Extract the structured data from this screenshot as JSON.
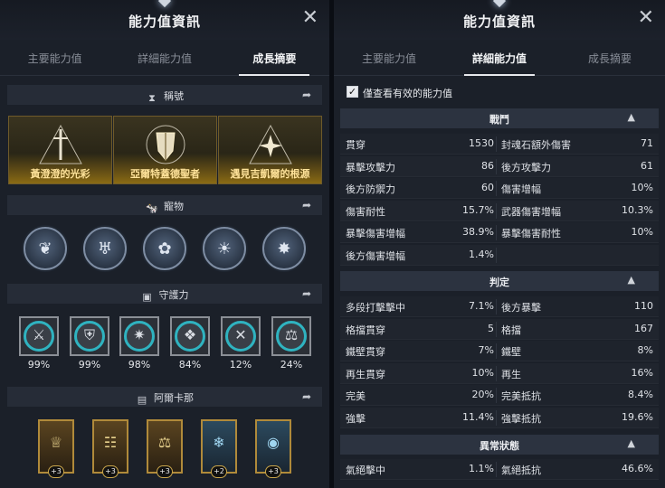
{
  "left": {
    "title": "能力值資訊",
    "close": "✕",
    "tabs": [
      "主要能力值",
      "詳細能力值",
      "成長摘要"
    ],
    "sections": {
      "titles": "稱號",
      "pets": "寵物",
      "guardians": "守護力",
      "arcana": "阿爾卡那"
    },
    "title_cards": [
      "黃澄澄的光彩",
      "亞爾特蓋德聖者",
      "遇見吉凱爾的根源"
    ],
    "pets_icons": [
      "wing-icon",
      "demon-icon",
      "lotus-icon",
      "sun-icon",
      "star-icon"
    ],
    "guardians": [
      {
        "icon": "sword-icon",
        "pct": "99%"
      },
      {
        "icon": "armor-icon",
        "pct": "99%"
      },
      {
        "icon": "beast-icon",
        "pct": "98%"
      },
      {
        "icon": "moth-icon",
        "pct": "84%"
      },
      {
        "icon": "cross-icon",
        "pct": "12%"
      },
      {
        "icon": "scale-icon",
        "pct": "24%"
      }
    ],
    "arcana": [
      {
        "icon": "chalice-icon",
        "count": "+3"
      },
      {
        "icon": "scroll-icon",
        "count": "+3"
      },
      {
        "icon": "balance-icon",
        "count": "+3"
      },
      {
        "icon": "crystal-icon",
        "count": "+2"
      },
      {
        "icon": "orb-icon",
        "count": "+3"
      }
    ],
    "colors": {
      "accent_gold": "#ffe39a",
      "guardian_ring": "#2fb3c0"
    }
  },
  "right": {
    "title": "能力值資訊",
    "close": "✕",
    "tabs": [
      "主要能力值",
      "詳細能力值",
      "成長摘要"
    ],
    "checkbox": {
      "label": "僅查看有效的能力值",
      "checked": "✓"
    },
    "groups": [
      {
        "name": "戰鬥",
        "rows": [
          [
            "貫穿",
            "1530",
            "封魂石額外傷害",
            "71"
          ],
          [
            "暴擊攻擊力",
            "86",
            "後方攻擊力",
            "61"
          ],
          [
            "後方防禦力",
            "60",
            "傷害增幅",
            "10%"
          ],
          [
            "傷害耐性",
            "15.7%",
            "武器傷害增幅",
            "10.3%"
          ],
          [
            "暴擊傷害增幅",
            "38.9%",
            "暴擊傷害耐性",
            "10%"
          ],
          [
            "後方傷害增幅",
            "1.4%",
            "",
            ""
          ]
        ]
      },
      {
        "name": "判定",
        "rows": [
          [
            "多段打擊擊中",
            "7.1%",
            "後方暴擊",
            "110"
          ],
          [
            "格擋貫穿",
            "5",
            "格擋",
            "167"
          ],
          [
            "鐵壁貫穿",
            "7%",
            "鐵壁",
            "8%"
          ],
          [
            "再生貫穿",
            "10%",
            "再生",
            "16%"
          ],
          [
            "完美",
            "20%",
            "完美抵抗",
            "8.4%"
          ],
          [
            "強擊",
            "11.4%",
            "強擊抵抗",
            "19.6%"
          ]
        ]
      },
      {
        "name": "異常狀態",
        "rows": [
          [
            "氣絕擊中",
            "1.1%",
            "氣絕抵抗",
            "46.6%"
          ]
        ]
      }
    ]
  }
}
